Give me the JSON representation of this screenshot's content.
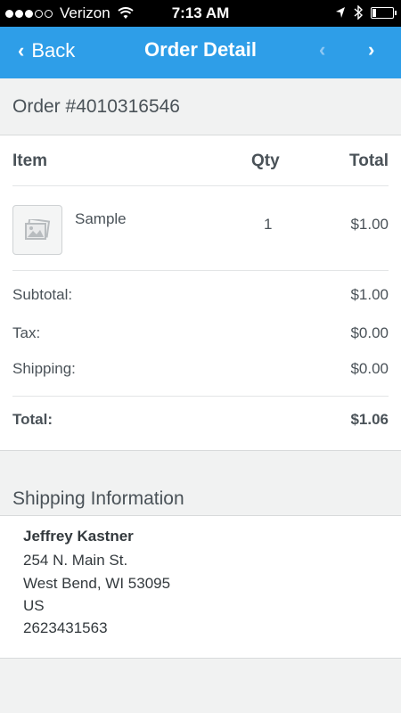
{
  "status": {
    "carrier": "Verizon",
    "time": "7:13 AM",
    "signal_bars_filled": 3,
    "signal_bars_total": 5
  },
  "nav": {
    "back_label": "Back",
    "title": "Order Detail",
    "prev_icon": "chevron-left-icon",
    "next_icon": "chevron-right-icon"
  },
  "order": {
    "number_label": "Order #4010316546"
  },
  "table": {
    "headers": {
      "item": "Item",
      "qty": "Qty",
      "total": "Total"
    },
    "items": [
      {
        "name": "Sample",
        "qty": "1",
        "total": "$1.00",
        "thumb_icon": "image-placeholder-icon"
      }
    ]
  },
  "summary": {
    "subtotal_label": "Subtotal:",
    "subtotal_value": "$1.00",
    "tax_label": "Tax:",
    "tax_value": "$0.00",
    "shipping_label": "Shipping:",
    "shipping_value": "$0.00",
    "total_label": "Total:",
    "total_value": "$1.06"
  },
  "shipping": {
    "section_title": "Shipping Information",
    "name": "Jeffrey Kastner",
    "street": "254 N. Main St.",
    "city_line": "West Bend, WI 53095",
    "country": "US",
    "phone": "2623431563"
  },
  "colors": {
    "accent": "#2e9ee8",
    "background": "#f1f2f2",
    "text": "#4a5258"
  }
}
